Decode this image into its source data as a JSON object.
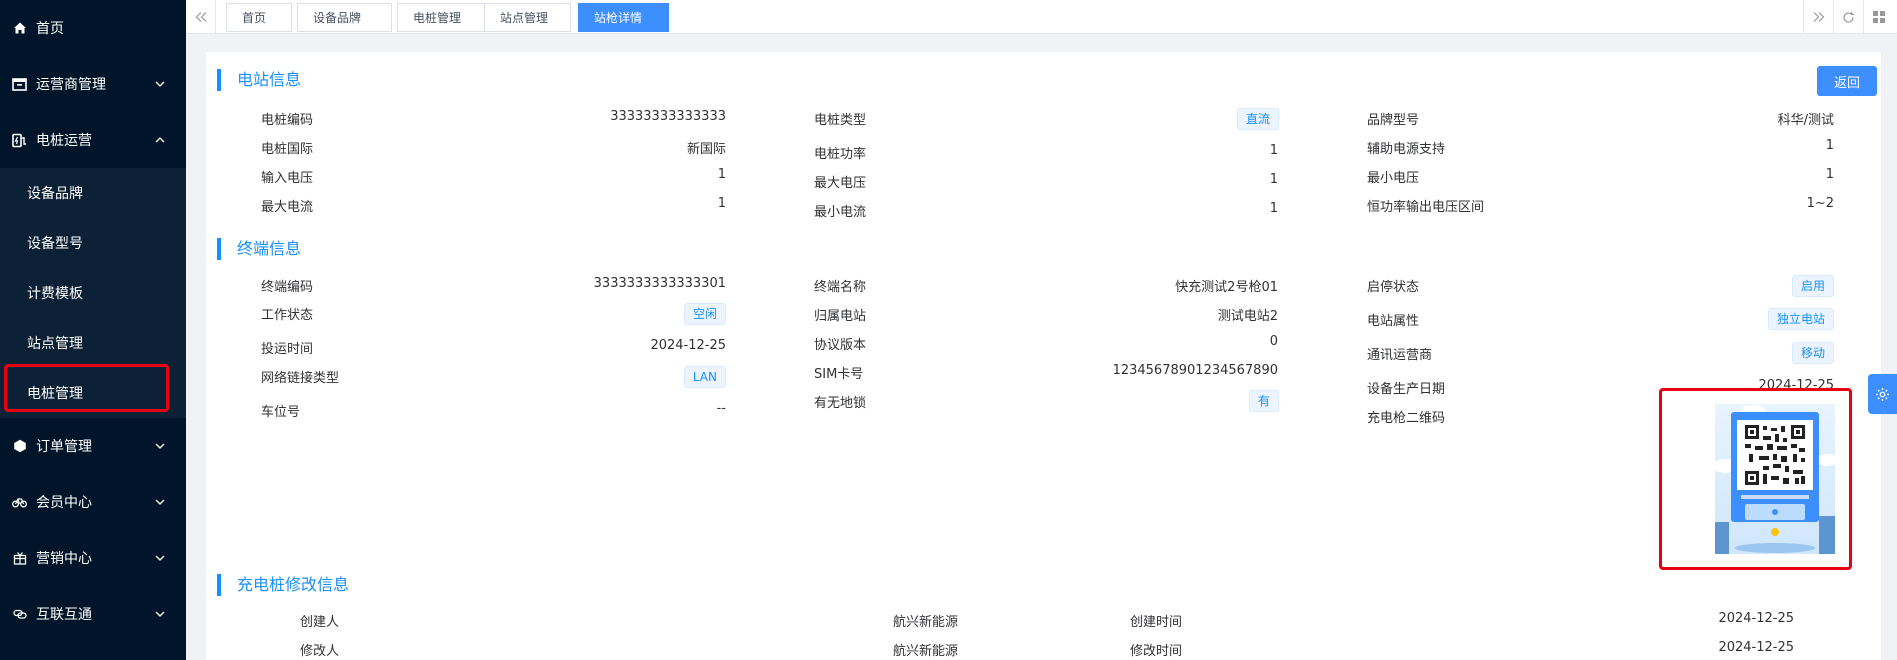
{
  "sidebar": {
    "home": "首页",
    "operator_mgmt": "运营商管理",
    "pile_ops": "电桩运营",
    "sub_items": [
      "设备品牌",
      "设备型号",
      "计费模板",
      "站点管理",
      "电桩管理"
    ],
    "order_mgmt": "订单管理",
    "member_center": "会员中心",
    "marketing_center": "营销中心",
    "interconnect": "互联互通"
  },
  "tabs": [
    "首页",
    "设备品牌",
    "电桩管理",
    "站点管理",
    "站枪详情"
  ],
  "back_button": "返回",
  "station": {
    "title": "电站信息",
    "col1": [
      {
        "label": "电桩编码",
        "value": "33333333333333"
      },
      {
        "label": "电桩国际",
        "value": "新国际"
      },
      {
        "label": "输入电压",
        "value": "1"
      },
      {
        "label": "最大电流",
        "value": "1"
      }
    ],
    "col2": [
      {
        "label": "电桩类型",
        "value": "直流"
      },
      {
        "label": "电桩功率",
        "value": "1"
      },
      {
        "label": "最大电压",
        "value": "1"
      },
      {
        "label": "最小电流",
        "value": "1"
      }
    ],
    "col3": [
      {
        "label": "品牌型号",
        "value": "科华/测试"
      },
      {
        "label": "辅助电源支持",
        "value": "1"
      },
      {
        "label": "最小电压",
        "value": "1"
      },
      {
        "label": "恒功率输出电压区间",
        "value": "1~2"
      }
    ]
  },
  "terminal": {
    "title": "终端信息",
    "col1": [
      {
        "label": "终端编码",
        "value": "3333333333333301"
      },
      {
        "label": "工作状态",
        "value": "空闲"
      },
      {
        "label": "投运时间",
        "value": "2024-12-25"
      },
      {
        "label": "网络链接类型",
        "value": "LAN"
      },
      {
        "label": "车位号",
        "value": "--"
      }
    ],
    "col2": [
      {
        "label": "终端名称",
        "value": "快充测试2号枪01"
      },
      {
        "label": "归属电站",
        "value": "测试电站2"
      },
      {
        "label": "协议版本",
        "value": "0"
      },
      {
        "label": "SIM卡号",
        "value": "12345678901234567890"
      },
      {
        "label": "有无地锁",
        "value": "有"
      }
    ],
    "col3": [
      {
        "label": "启停状态",
        "value": "启用"
      },
      {
        "label": "电站属性",
        "value": "独立电站"
      },
      {
        "label": "通讯运营商",
        "value": "移动"
      },
      {
        "label": "设备生产日期",
        "value": "2024-12-25"
      },
      {
        "label": "充电枪二维码",
        "value": ""
      }
    ]
  },
  "modify": {
    "title": "充电桩修改信息",
    "rows": [
      {
        "label": "创建人",
        "value": "航兴新能源",
        "time_label": "创建时间",
        "time": "2024-12-25"
      },
      {
        "label": "修改人",
        "value": "航兴新能源",
        "time_label": "修改时间",
        "time": "2024-12-25"
      }
    ]
  },
  "colors": {
    "accent": "#1890ff",
    "sidebar_bg": "#001529",
    "highlight": "#e60012"
  }
}
